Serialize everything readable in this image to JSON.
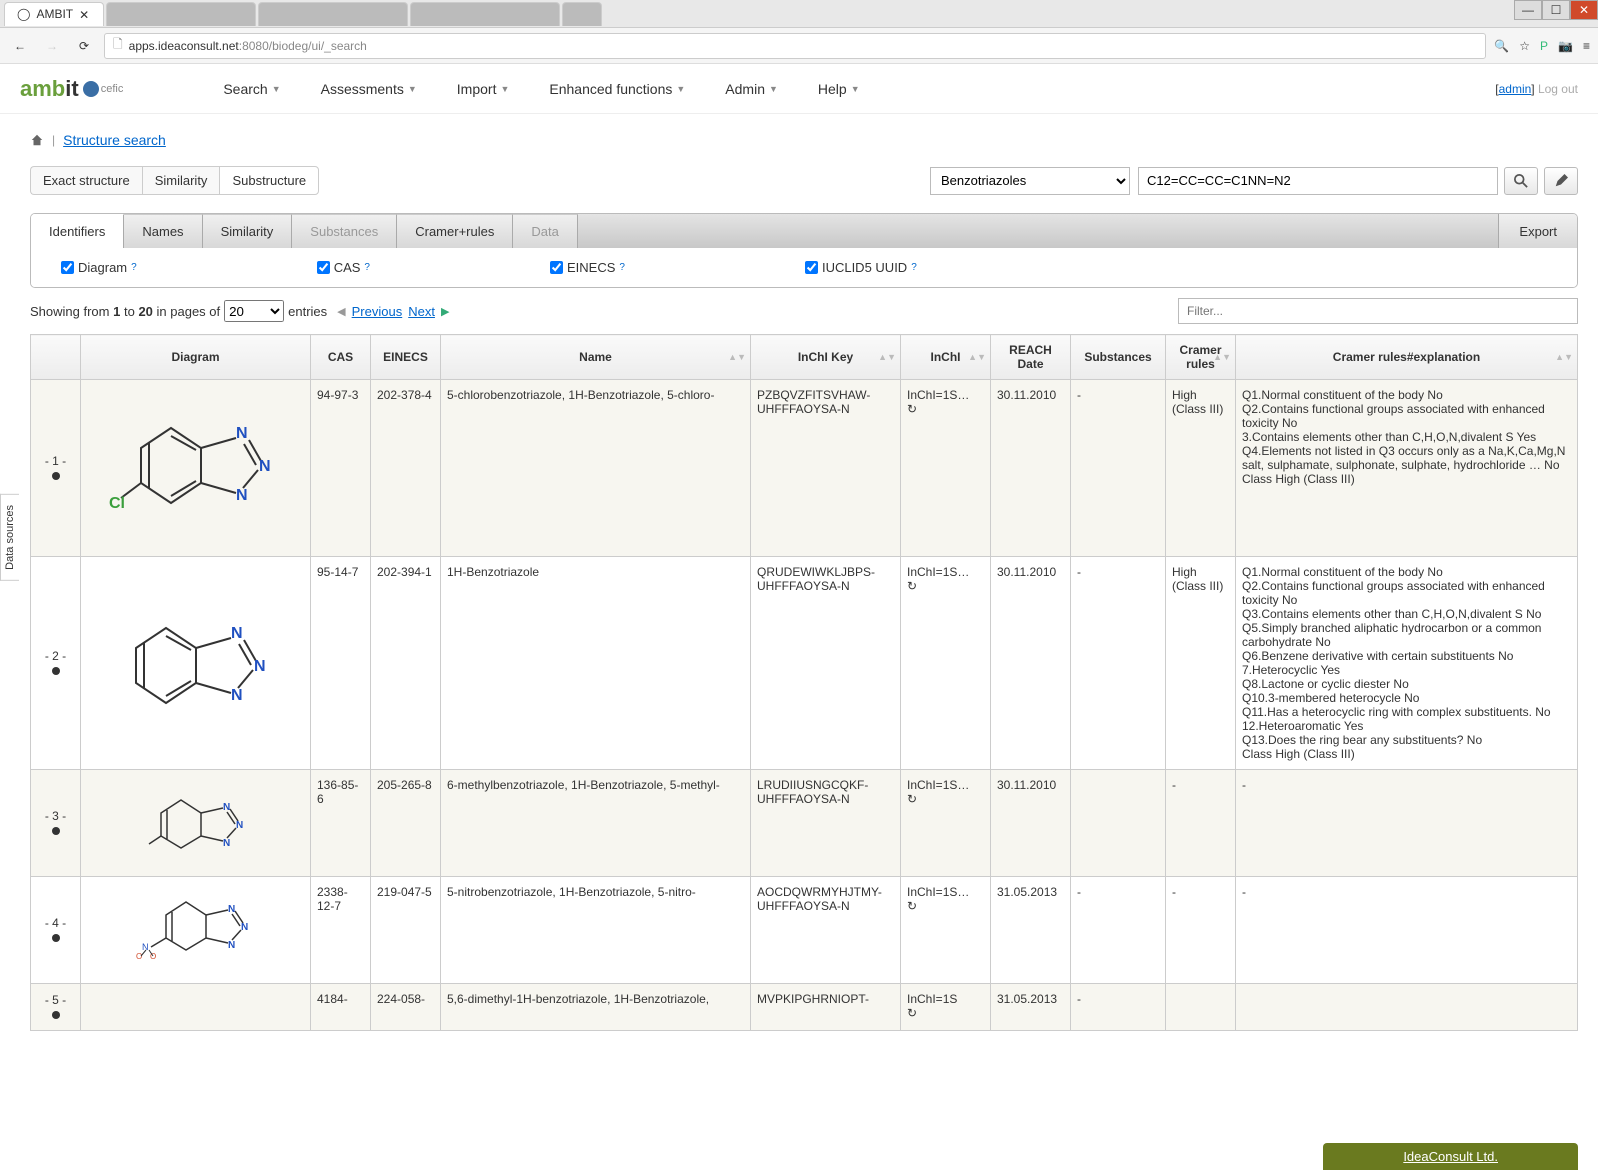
{
  "browser": {
    "tab_title": "AMBIT",
    "url_host": "apps.ideaconsult.net",
    "url_port": ":8080",
    "url_path": "/biodeg/ui/_search"
  },
  "nav": {
    "items": [
      "Search",
      "Assessments",
      "Import",
      "Enhanced functions",
      "Admin",
      "Help"
    ],
    "admin": "admin",
    "logout": "Log out"
  },
  "breadcrumb": {
    "link": "Structure search"
  },
  "search": {
    "tabs": [
      "Exact structure",
      "Similarity",
      "Substructure"
    ],
    "active_tab": 2,
    "category": "Benzotriazoles",
    "smiles": "C12=CC=CC=C1NN=N2"
  },
  "result_tabs": {
    "items": [
      {
        "label": "Identifiers",
        "active": true
      },
      {
        "label": "Names"
      },
      {
        "label": "Similarity"
      },
      {
        "label": "Substances",
        "disabled": true
      },
      {
        "label": "Cramer+rules"
      },
      {
        "label": "Data",
        "disabled": true
      }
    ],
    "export": "Export"
  },
  "col_toggles": [
    "Diagram",
    "CAS",
    "EINECS",
    "IUCLID5 UUID"
  ],
  "pagination": {
    "prefix": "Showing from",
    "from": "1",
    "to_word": "to",
    "to": "20",
    "suffix": "in pages of",
    "per_page": "20",
    "entries": "entries",
    "previous": "Previous",
    "next": "Next"
  },
  "filter_placeholder": "Filter...",
  "columns": [
    "",
    "Diagram",
    "CAS",
    "EINECS",
    "Name",
    "InChI Key",
    "InChI",
    "REACH Date",
    "Substances",
    "Cramer rules",
    "Cramer rules#explanation"
  ],
  "rows": [
    {
      "idx": "- 1 -",
      "cas": "94-97-3",
      "einecs": "202-378-4",
      "name": "5-chlorobenzotriazole, 1H-Benzotriazole, 5-chloro-",
      "inchikey": "PZBQVZFITSVHAW-UHFFFAOYSA-N",
      "inchi": "InChI=1S…",
      "reach": "30.11.2010",
      "subst": "-",
      "cramer": "High (Class III)",
      "explain": "Q1.Normal constituent of the body No\nQ2.Contains functional groups associated with enhanced toxicity No\n3.Contains elements other than C,H,O,N,divalent S Yes\nQ4.Elements not listed in Q3 occurs only as a Na,K,Ca,Mg,N salt, sulphamate, sulphonate, sulphate, hydrochloride … No\nClass High (Class III)"
    },
    {
      "idx": "- 2 -",
      "cas": "95-14-7",
      "einecs": "202-394-1",
      "name": "1H-Benzotriazole",
      "inchikey": "QRUDEWIWKLJBPS-UHFFFAOYSA-N",
      "inchi": "InChI=1S…",
      "reach": "30.11.2010",
      "subst": "-",
      "cramer": "High (Class III)",
      "explain": "Q1.Normal constituent of the body No\nQ2.Contains functional groups associated with enhanced toxicity No\nQ3.Contains elements other than C,H,O,N,divalent S No\nQ5.Simply branched aliphatic hydrocarbon or a common carbohydrate No\nQ6.Benzene derivative with certain substituents No\n7.Heterocyclic Yes\nQ8.Lactone or cyclic diester No\nQ10.3-membered heterocycle No\nQ11.Has a heterocyclic ring with complex substituents. No\n12.Heteroaromatic Yes\nQ13.Does the ring bear any substituents? No\nClass High (Class III)"
    },
    {
      "idx": "- 3 -",
      "cas": "136-85-6",
      "einecs": "205-265-8",
      "name": "6-methylbenzotriazole, 1H-Benzotriazole, 5-methyl-",
      "inchikey": "LRUDIIUSNGCQKF-UHFFFAOYSA-N",
      "inchi": "InChI=1S…",
      "reach": "30.11.2010",
      "subst": "",
      "cramer": "-",
      "explain": "-"
    },
    {
      "idx": "- 4 -",
      "cas": "2338-12-7",
      "einecs": "219-047-5",
      "name": "5-nitrobenzotriazole, 1H-Benzotriazole, 5-nitro-",
      "inchikey": "AOCDQWRMYHJTMY-UHFFFAOYSA-N",
      "inchi": "InChI=1S…",
      "reach": "31.05.2013",
      "subst": "-",
      "cramer": "-",
      "explain": "-"
    },
    {
      "idx": "- 5 -",
      "cas": "4184-",
      "einecs": "224-058-",
      "name": "5,6-dimethyl-1H-benzotriazole, 1H-Benzotriazole,",
      "inchikey": "MVPKIPGHRNIOPT-",
      "inchi": "InChI=1S",
      "reach": "31.05.2013",
      "subst": "-",
      "cramer": "",
      "explain": ""
    }
  ],
  "side_tab": "Data sources",
  "footer": "IdeaConsult Ltd."
}
